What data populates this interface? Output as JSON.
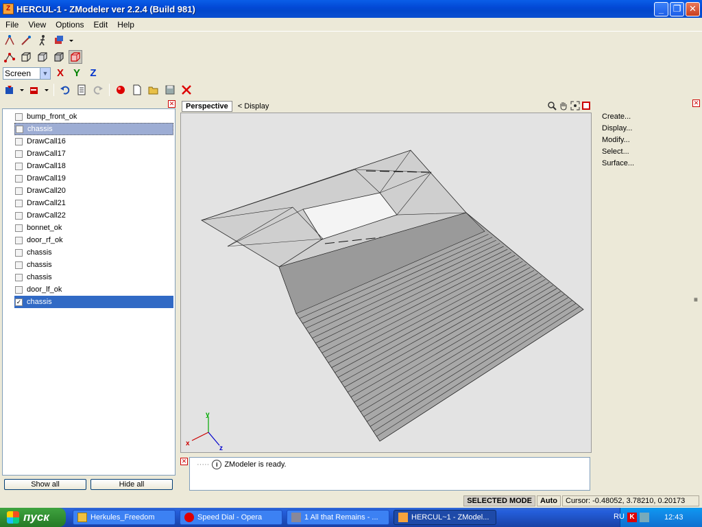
{
  "window": {
    "title": "HERCUL-1 - ZModeler ver 2.2.4 (Build 981)",
    "app_icon": "Z",
    "minimize": "_",
    "maximize": "❐",
    "close": "✕"
  },
  "menu": [
    "File",
    "View",
    "Options",
    "Edit",
    "Help"
  ],
  "toolbar": {
    "coord_select": "Screen",
    "axis_x": "X",
    "axis_y": "Y",
    "axis_z": "Z",
    "colors": {
      "axis_x": "#cc0000",
      "axis_y": "#008000",
      "axis_z": "#0033cc"
    }
  },
  "objects": [
    {
      "name": "bump_front_ok",
      "checked": false,
      "state": "none"
    },
    {
      "name": "chassis",
      "checked": false,
      "state": "grey"
    },
    {
      "name": "DrawCall16",
      "checked": false,
      "state": "none"
    },
    {
      "name": "DrawCall17",
      "checked": false,
      "state": "none"
    },
    {
      "name": "DrawCall18",
      "checked": false,
      "state": "none"
    },
    {
      "name": "DrawCall19",
      "checked": false,
      "state": "none"
    },
    {
      "name": "DrawCall20",
      "checked": false,
      "state": "none"
    },
    {
      "name": "DrawCall21",
      "checked": false,
      "state": "none"
    },
    {
      "name": "DrawCall22",
      "checked": false,
      "state": "none"
    },
    {
      "name": "bonnet_ok",
      "checked": false,
      "state": "none"
    },
    {
      "name": "door_rf_ok",
      "checked": false,
      "state": "none"
    },
    {
      "name": "chassis",
      "checked": false,
      "state": "none"
    },
    {
      "name": "chassis",
      "checked": false,
      "state": "none"
    },
    {
      "name": "chassis",
      "checked": false,
      "state": "none"
    },
    {
      "name": "door_lf_ok",
      "checked": false,
      "state": "none"
    },
    {
      "name": "chassis",
      "checked": true,
      "state": "blue"
    }
  ],
  "left_buttons": {
    "show_all": "Show all",
    "hide_all": "Hide all"
  },
  "viewport": {
    "tab": "Perspective",
    "display": "< Display",
    "axis_labels": {
      "x": "x",
      "y": "y",
      "z": "z"
    }
  },
  "console": {
    "message": "ZModeler is ready."
  },
  "right_panel": [
    "Create...",
    "Display...",
    "Modify...",
    "Select...",
    "Surface..."
  ],
  "status": {
    "mode": "SELECTED MODE",
    "auto": "Auto",
    "cursor": "Cursor: -0.48052, 3.78210, 0.20173"
  },
  "taskbar": {
    "start": "пуск",
    "tasks": [
      "Herkules_Freedom",
      "Speed Dial - Opera",
      "1 All that Remains - ...",
      "HERCUL~1 - ZModel..."
    ],
    "lang": "RU",
    "clock": "12:43"
  }
}
